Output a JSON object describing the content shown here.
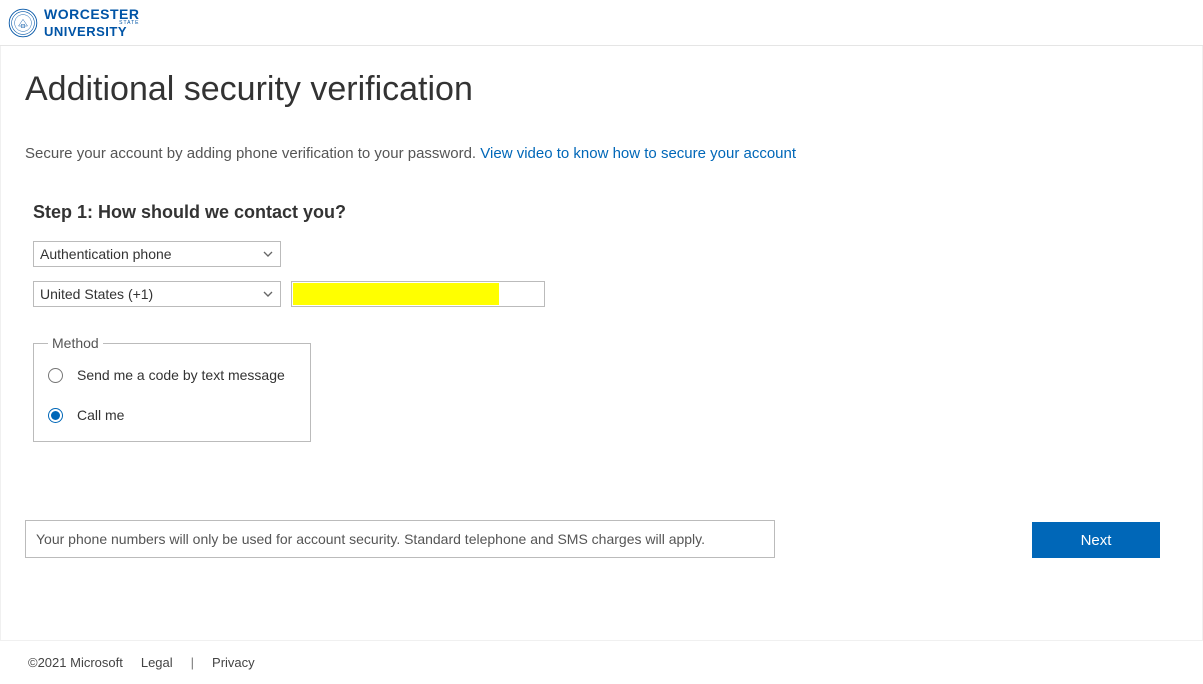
{
  "header": {
    "logo": {
      "top": "WORCESTER",
      "state": "STATE",
      "bottom": "UNIVERSITY"
    }
  },
  "page": {
    "title": "Additional security verification",
    "subtitle_text": "Secure your account by adding phone verification to your password. ",
    "subtitle_link": "View video to know how to secure your account"
  },
  "step": {
    "heading": "Step 1: How should we contact you?",
    "contact_method_selected": "Authentication phone",
    "country_selected": "United States (+1)",
    "phone_value": ""
  },
  "method": {
    "legend": "Method",
    "option_text": "Send me a code by text message",
    "option_call": "Call me",
    "selected": "call"
  },
  "actions": {
    "next": "Next"
  },
  "disclaimer": "Your phone numbers will only be used for account security. Standard telephone and SMS charges will apply.",
  "footer": {
    "copyright": "©2021 Microsoft",
    "legal": "Legal",
    "privacy": "Privacy"
  }
}
